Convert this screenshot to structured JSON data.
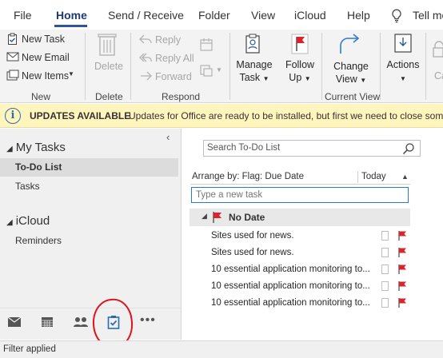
{
  "menu": {
    "tabs": [
      {
        "label": "File"
      },
      {
        "label": "Home",
        "active": true
      },
      {
        "label": "Send / Receive"
      },
      {
        "label": "Folder"
      },
      {
        "label": "View"
      },
      {
        "label": "iCloud"
      },
      {
        "label": "Help"
      },
      {
        "label": "Tell me"
      }
    ]
  },
  "ribbon": {
    "new_group": {
      "label": "New",
      "new_task": "New Task",
      "new_email": "New Email",
      "new_items": "New Items"
    },
    "delete_group": {
      "label": "Delete",
      "delete": "Delete"
    },
    "respond_group": {
      "label": "Respond",
      "reply": "Reply",
      "reply_all": "Reply All",
      "forward": "Forward"
    },
    "current_view_group": {
      "label": "Current View",
      "manage_task_1": "Manage",
      "manage_task_2": "Task",
      "follow_up_1": "Follow",
      "follow_up_2": "Up",
      "change_view_1": "Change",
      "change_view_2": "View",
      "actions": "Actions",
      "cal": "Ca"
    }
  },
  "infobar": {
    "title": "UPDATES AVAILABLE",
    "message": "Updates for Office are ready to be installed, but first we need to close some"
  },
  "nav": {
    "my_tasks": "My Tasks",
    "todo_list": "To-Do List",
    "tasks": "Tasks",
    "icloud": "iCloud",
    "reminders": "Reminders"
  },
  "main": {
    "search_placeholder": "Search To-Do List",
    "arrange_by": "Arrange by: Flag: Due Date",
    "today": "Today",
    "new_task_placeholder": "Type a new task",
    "group_title": "No Date",
    "tasks": [
      {
        "title": "Sites used for news."
      },
      {
        "title": "Sites used for news."
      },
      {
        "title": "10 essential application monitoring to..."
      },
      {
        "title": "10 essential application monitoring to..."
      },
      {
        "title": "10 essential application monitoring to..."
      }
    ]
  },
  "status": {
    "text": "Filter applied"
  },
  "colors": {
    "accent": "#2b579a",
    "flag_red": "#d9242b",
    "infobar_bg": "#fff5bd",
    "annotation_circle": "#e0131c"
  }
}
